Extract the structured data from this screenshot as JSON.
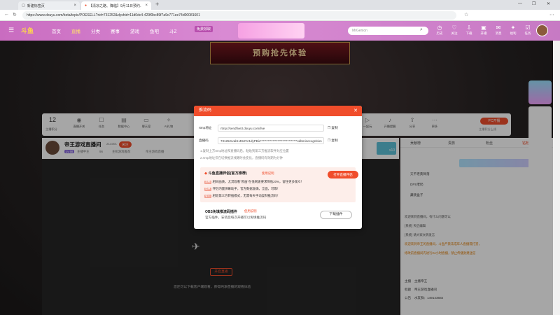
{
  "browser": {
    "tabs": [
      {
        "label": "新建标签页",
        "active": false
      },
      {
        "label": "【清凉之路、降临】9月11日预约...",
        "active": true
      }
    ],
    "new_tab": "+",
    "url": "https://www.douyu.com/beta/topic/POESELL?rid=731252&dyshid=11d0dc4-429f0bc89f7a9c771ee74d00081601",
    "window_controls": [
      "—",
      "❐",
      "✕"
    ]
  },
  "site": {
    "logo": "斗鱼",
    "nav": [
      "首页",
      "直播",
      "分类",
      "赛事",
      "游戏",
      "鱼吧",
      "斗Z"
    ],
    "active_nav": "直播",
    "promo_badge": "免费领取",
    "search_placeholder": "MrGenion",
    "header_icons": [
      "历史",
      "关注",
      "下载",
      "开播",
      "消息",
      "福利",
      "任务"
    ]
  },
  "event_banner": "预购抢先体验",
  "toolbar": {
    "count": "12",
    "count_label": "主播积分",
    "items": [
      "直播开关",
      "任务",
      "数据中心",
      "聊天室",
      "AI礼物",
      "一起玩",
      "开播提醒",
      "分享",
      "更多"
    ],
    "pc_button": "PC开播",
    "pc_sub": "主播积分上线"
  },
  "room": {
    "streamer": "帝王游戏直播间",
    "room_id": "213301",
    "follow": "关注",
    "level": "Lv 58",
    "category": "主播平王",
    "fans": "96",
    "tags": [
      "主机游戏推荐",
      "帝王游戏直播"
    ],
    "promo_count": "x10"
  },
  "video": {
    "open_button": "开启直播",
    "tip": "您还可以下载客户端观看，获得纯净直播的观看体验"
  },
  "right_panel": {
    "tabs": [
      "贡献榜",
      "贵族",
      "粉丝",
      "钻粉"
    ],
    "ranks": [
      "天不老黄降落",
      "DPS老奶",
      "藏晓盒子"
    ],
    "chat": [
      "欢迎来到直播间，有什么问题可以",
      "[系统] 天启编辑",
      "[系统] 请大家文明发言",
      "欢迎来到帝王的直播间，斗鱼严禁未成年人直播或打赏，",
      "修改前直播间内进行24小时直播，禁止传播封建迷信"
    ],
    "footer": [
      {
        "label": "主播",
        "value": "主播帝王"
      },
      {
        "label": "标题",
        "value": "帝王游戏直播间"
      },
      {
        "label": "公告",
        "value": "水友群：149143682"
      }
    ]
  },
  "modal": {
    "title": "推流码",
    "close": "✕",
    "server_label": "rtmp地址",
    "server_value": "rtmp://sendfive3.douyu.com/live",
    "key_label": "直播码",
    "key_value": "731252rvabH49vNV1dyPBix******************************xdbminecognition",
    "copy": "复制",
    "notes": [
      "1.复制上方rtmp地址和直播码后，粘贴到第三方推流软件对应位置",
      "2.rtmp地址仅在切换推流线路时会变化，直播码有效期为分钟"
    ],
    "promo": {
      "title": "斗鱼直播伴侣(官方推荐)",
      "link": "使用说明",
      "open_button": "打开直播伴侣",
      "lines": [
        {
          "tag": "流畅",
          "text": "相同画质，尤其观看\"原画\"在低网速要求降低20%，留住更多观众！"
        },
        {
          "tag": "简单",
          "text": "伴侣内置弹幕助手，官方数据准确，全面，可靠！"
        },
        {
          "tag": "省心",
          "text": "相较第三方转推模式，无需每天手动复制推流码！"
        }
      ]
    },
    "obs": {
      "title": "OBS免填推流码插件",
      "link": "使用说明",
      "desc": "官方插件，安装后每次开播可以免填推流码",
      "button": "下载插件"
    }
  },
  "colors": {
    "brand": "#f04d2b",
    "header": "#d98ad3"
  }
}
